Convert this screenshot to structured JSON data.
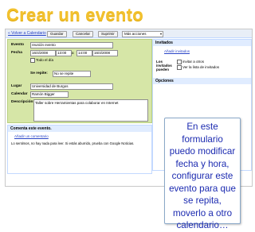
{
  "slide_title": "Crear un evento",
  "toolbar": {
    "back_link": "« Volver a Calendario",
    "save_label": "Guardar",
    "cancel_label": "Cancelar",
    "delete_label": "Suprimir",
    "more_actions": "Más acciones"
  },
  "form": {
    "event_label": "Evento",
    "event_value": "reunión evento",
    "date_label": "Fecha",
    "start_date": "16/4/2008",
    "start_time": "13:00",
    "to_word": "a",
    "end_time": "14:00",
    "end_date": "16/4/2008",
    "all_day_label": "Todo el día",
    "repeat_label": "Se repite:",
    "repeat_value": "No se repite",
    "where_label": "Lugar",
    "where_value": "Universidad de Burgos",
    "calendar_label": "Calendar",
    "calendar_value": "Ramón Bigger",
    "description_label": "Descripción",
    "description_value": "Taller sobre Herramientas para colaborar en Internet"
  },
  "guests": {
    "header": "Invitados",
    "add_link": "Añadir invitados",
    "guests_can_label": "Los invitados pueden",
    "option_invite": "invitar a otros",
    "option_see_list": "Ver la lista de invitados"
  },
  "options": {
    "header": "Opciones"
  },
  "comments": {
    "header": "Comenta este evento.",
    "add_link": "Añadir un comentario",
    "notice": "Lo sentimos, no hay nada para leer. Si estás aburrido, prueba con Google Noticias."
  },
  "callout": {
    "text": "En este formulario puedo modificar fecha y hora, configurar este evento para que se repita, moverlo a otro calendario…"
  },
  "colors": {
    "title": "#f2c12e",
    "form_background": "#d6e6a7",
    "header_background": "#e0ecff",
    "link": "#2a45c7",
    "callout_text": "#1b2ab0"
  }
}
